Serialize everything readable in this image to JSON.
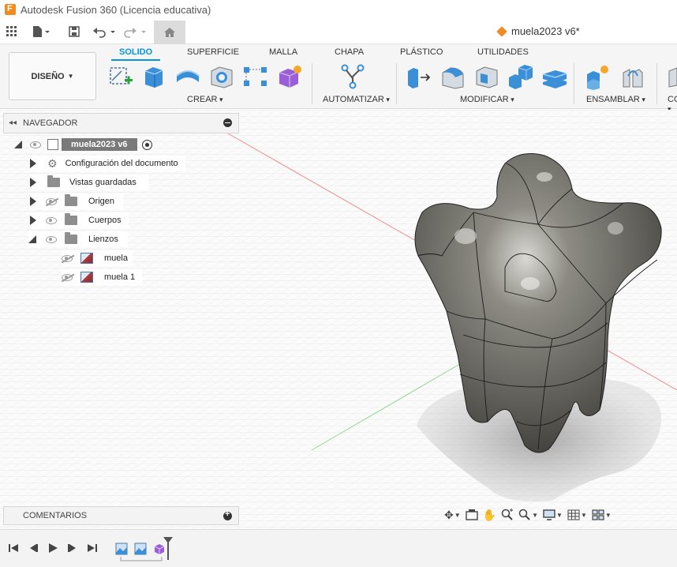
{
  "window": {
    "title": "Autodesk Fusion 360 (Licencia educativa)"
  },
  "document_tab": {
    "name": "muela2023 v6*"
  },
  "workspace": {
    "label": "DISEÑO"
  },
  "ribbon": {
    "tabs": [
      {
        "label": "SOLIDO",
        "active": true
      },
      {
        "label": "SUPERFICIE"
      },
      {
        "label": "MALLA"
      },
      {
        "label": "CHAPA"
      },
      {
        "label": "PLÁSTICO"
      },
      {
        "label": "UTILIDADES"
      }
    ],
    "groups": [
      {
        "label": "CREAR",
        "icons": [
          "create-sketch-icon",
          "extrude-icon",
          "revolve-icon",
          "hole-icon",
          "pattern-icon",
          "form-icon"
        ]
      },
      {
        "label": "AUTOMATIZAR",
        "icons": [
          "automate-icon"
        ]
      },
      {
        "label": "MODIFICAR",
        "icons": [
          "press-pull-icon",
          "fillet-icon",
          "shell-icon",
          "combine-icon",
          "offset-face-icon"
        ]
      },
      {
        "label": "ENSAMBLAR",
        "icons": [
          "new-component-icon",
          "joint-icon"
        ]
      },
      {
        "label": "CO"
      }
    ]
  },
  "navigator": {
    "title": "NAVEGADOR",
    "root": {
      "label": "muela2023 v6"
    },
    "items": [
      {
        "label": "Configuración del documento"
      },
      {
        "label": "Vistas guardadas"
      },
      {
        "label": "Origen"
      },
      {
        "label": "Cuerpos"
      },
      {
        "label": "Lienzos"
      },
      {
        "label": "muela"
      },
      {
        "label": "muela 1"
      }
    ]
  },
  "comments": {
    "title": "COMENTARIOS"
  },
  "colors": {
    "accent": "#0696d7",
    "brand": "#f28a1e",
    "model": "#6b6a64"
  }
}
